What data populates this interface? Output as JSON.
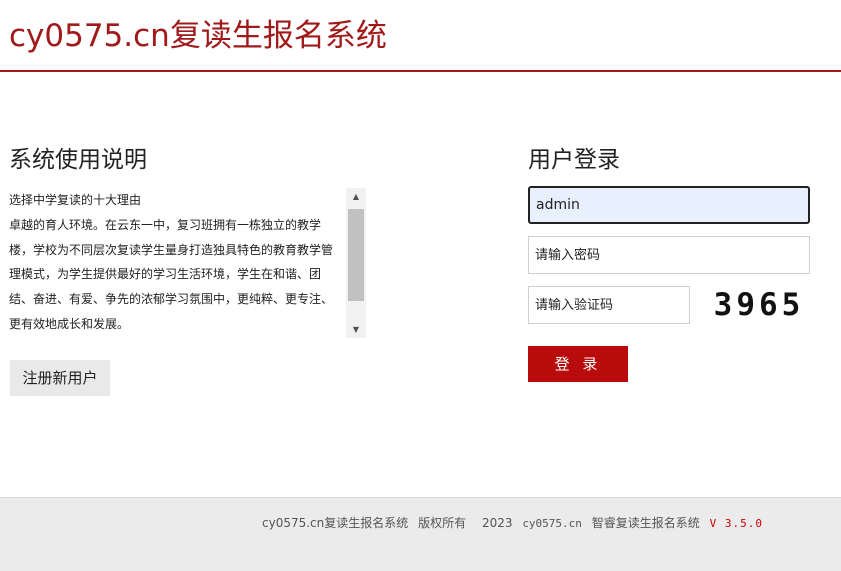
{
  "header": {
    "title": "cy0575.cn复读生报名系统"
  },
  "instructions": {
    "title": "系统使用说明",
    "lines": [
      "选择中学复读的十大理由",
      "卓越的育人环境。在云东一中，复习班拥有一栋独立的教学",
      "楼，学校为不同层次复读学生量身打造独具特色的教育教学管",
      "理模式，为学生提供最好的学习生活环境，学生在和谐、团",
      "结、奋进、有爱、争先的浓郁学习氛围中，更纯粹、更专注、",
      "更有效地成长和发展。"
    ],
    "scroll_up_icon": "triangle-up",
    "scroll_down_icon": "triangle-down"
  },
  "register_button": {
    "label": "注册新用户"
  },
  "login": {
    "title": "用户登录",
    "username_value": "admin",
    "password_placeholder": "请输入密码",
    "captcha_placeholder": "请输入验证码",
    "captcha_text": "3965",
    "submit_label": "登 录"
  },
  "footer": {
    "site": "cy0575.cn复读生报名系统",
    "rights": "版权所有",
    "year": "2023",
    "domain": "cy0575.cn",
    "product": "智睿复读生报名系统",
    "version": "V 3.5.0"
  },
  "colors": {
    "brand": "#a11a1a",
    "button": "#b80b0b",
    "version": "#cc0000"
  }
}
